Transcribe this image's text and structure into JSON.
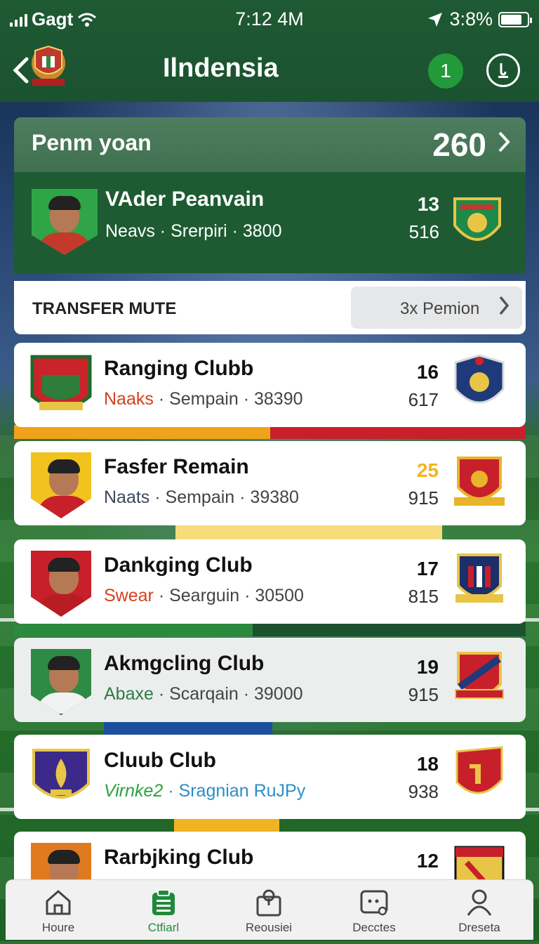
{
  "status_bar": {
    "carrier": "Gagt",
    "time": "7:12 4M",
    "battery": "3:8%",
    "battery_level_pct": 80
  },
  "header": {
    "back_icon": "chevron-left-icon",
    "title": "Ilndensia",
    "notification_count": "1",
    "help_icon": "info-icon"
  },
  "featured": {
    "label": "Penm yoan",
    "value": "260",
    "player": {
      "name": "VAder Peanvain",
      "sub": "Neavs · Srerpiri · 3800",
      "num_top": "13",
      "num_bottom": "516"
    }
  },
  "transfer": {
    "label": "TRANSFER MUTE",
    "button": "3x Pemion"
  },
  "clubs": [
    {
      "name": "Ranging Clubb",
      "tag": "Naaks",
      "sub": " · Sempain · 38390",
      "num_top": "16",
      "num_bottom": "617",
      "tag_color": "#d4411e",
      "num_top_color": "#111111"
    },
    {
      "name": "Fasfer Remain",
      "tag": "Naats",
      "sub": " · Sempain · 39380",
      "num_top": "25",
      "num_bottom": "915",
      "tag_color": "#3a4a5c",
      "num_top_color": "#f2b51b"
    },
    {
      "name": "Dankging Club",
      "tag": "Swear",
      "sub": " · Searguin · 30500",
      "num_top": "17",
      "num_bottom": "815",
      "tag_color": "#d4411e",
      "num_top_color": "#111111"
    },
    {
      "name": "Akmgcling Club",
      "tag": "Abaxe",
      "sub": " · Scarqain · 39000",
      "num_top": "19",
      "num_bottom": "915",
      "tag_color": "#2e7d43",
      "num_top_color": "#111111"
    },
    {
      "name": "Cluub Club",
      "tag": "Virnke2",
      "sub": " · Sragnian RuJPy",
      "num_top": "18",
      "num_bottom": "938",
      "tag_color": "#2aa33c",
      "num_top_color": "#111111"
    },
    {
      "name": "Rarbjking Club",
      "tag": "",
      "sub": "",
      "num_top": "12",
      "num_bottom": "",
      "tag_color": "#444444",
      "num_top_color": "#111111"
    }
  ],
  "bottom_nav": [
    {
      "label": "Houre",
      "icon": "home-icon"
    },
    {
      "label": "Ctfiarl",
      "icon": "clipboard-icon"
    },
    {
      "label": "Reousiei",
      "icon": "search-document-icon"
    },
    {
      "label": "Decctes",
      "icon": "chat-icon"
    },
    {
      "label": "Dreseta",
      "icon": "user-icon"
    }
  ],
  "colors": {
    "header_green": "#1e5a33",
    "accent_green": "#229a3a",
    "card_green": "#1e5b33"
  }
}
